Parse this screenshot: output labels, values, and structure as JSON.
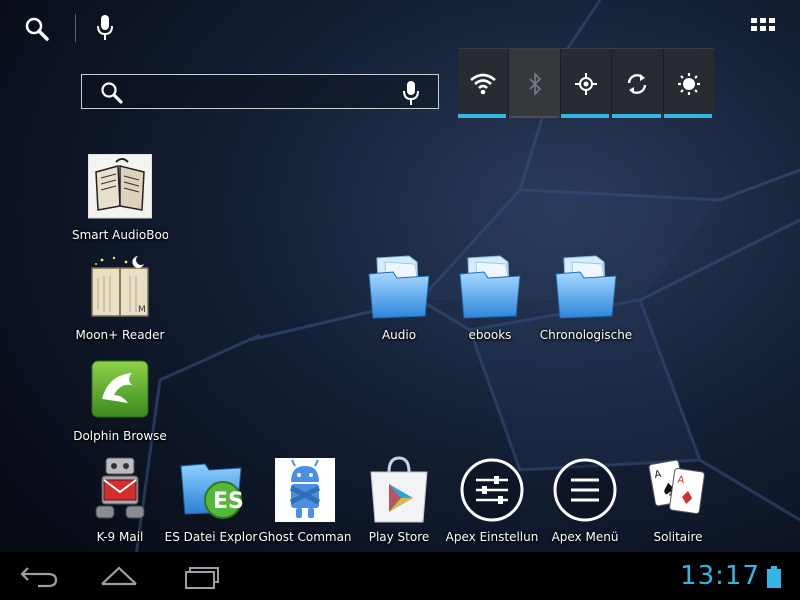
{
  "desktop": {
    "row_left": [
      {
        "id": "smart-audiobook",
        "label": "Smart AudioBoo",
        "icon": "audiobook-icon"
      },
      {
        "id": "moon-reader",
        "label": "Moon+ Reader",
        "icon": "moon-reader-icon"
      },
      {
        "id": "dolphin-browser",
        "label": "Dolphin Browse",
        "icon": "dolphin-icon"
      }
    ],
    "folders": [
      {
        "id": "audio",
        "label": "Audio"
      },
      {
        "id": "ebooks",
        "label": "ebooks"
      },
      {
        "id": "chronologische",
        "label": "Chronologische"
      }
    ]
  },
  "dock": [
    {
      "id": "k9-mail",
      "label": "K-9 Mail",
      "icon": "k9-mail-icon"
    },
    {
      "id": "es-file-explorer",
      "label": "ES Datei Explor",
      "icon": "es-file-explorer-icon"
    },
    {
      "id": "ghost-commander",
      "label": "Ghost Comman",
      "icon": "ghost-commander-icon"
    },
    {
      "id": "play-store",
      "label": "Play Store",
      "icon": "play-store-icon"
    },
    {
      "id": "apex-settings",
      "label": "Apex Einstellun",
      "icon": "apex-settings-icon"
    },
    {
      "id": "apex-menu",
      "label": "Apex Menü",
      "icon": "apex-menu-icon"
    },
    {
      "id": "solitaire",
      "label": "Solitaire",
      "icon": "solitaire-icon"
    }
  ],
  "search": {
    "value": "",
    "placeholder": ""
  },
  "power_widget": [
    {
      "id": "wifi",
      "icon": "wifi-icon",
      "state": "on"
    },
    {
      "id": "bluetooth",
      "icon": "bluetooth-icon",
      "state": "off"
    },
    {
      "id": "gps",
      "icon": "gps-icon",
      "state": "on"
    },
    {
      "id": "sync",
      "icon": "sync-icon",
      "state": "on"
    },
    {
      "id": "brightness",
      "icon": "brightness-icon",
      "state": "on"
    }
  ],
  "status_bar": {
    "time": "13:17",
    "battery": "full"
  },
  "colors": {
    "accent": "#33b5e5",
    "navbar": "#000000"
  }
}
